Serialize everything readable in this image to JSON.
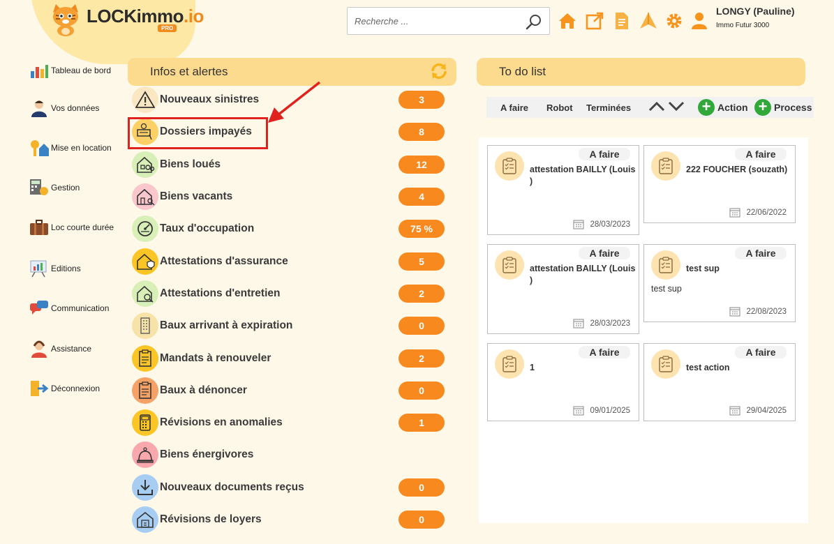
{
  "header": {
    "logo_main": "LOCKimmo",
    "logo_suffix": ".io",
    "logo_badge": "PRO",
    "search_placeholder": "Recherche ...",
    "user_name": "LONGY (Pauline)",
    "user_company": "Immo Futur 3000"
  },
  "icons": {
    "accent": "#f08a1c",
    "badge_color": "#f7891f",
    "panel_color": "#fddb8e",
    "highlight_color": "#e0221f"
  },
  "sidebar": {
    "items": [
      {
        "label": "Tableau de bord",
        "icon": "dashboard-icon"
      },
      {
        "label": "Vos données",
        "icon": "person-icon"
      },
      {
        "label": "Mise en location",
        "icon": "key-house-icon"
      },
      {
        "label": "Gestion",
        "icon": "calculator-icon"
      },
      {
        "label": "Loc courte durée",
        "icon": "suitcase-icon"
      },
      {
        "label": "Editions",
        "icon": "report-icon"
      },
      {
        "label": "Communication",
        "icon": "chat-icon"
      },
      {
        "label": "Assistance",
        "icon": "support-icon"
      },
      {
        "label": "Déconnexion",
        "icon": "logout-icon"
      }
    ]
  },
  "alerts": {
    "title": "Infos et alertes",
    "items": [
      {
        "label": "Nouveaux sinistres",
        "count": "3"
      },
      {
        "label": "Dossiers impayés",
        "count": "8"
      },
      {
        "label": "Biens loués",
        "count": "12"
      },
      {
        "label": "Biens vacants",
        "count": "4"
      },
      {
        "label": "Taux d'occupation",
        "count": "75 %"
      },
      {
        "label": "Attestations d'assurance",
        "count": "5"
      },
      {
        "label": "Attestations d'entretien",
        "count": "2"
      },
      {
        "label": "Baux arrivant à expiration",
        "count": "0"
      },
      {
        "label": "Mandats à renouveler",
        "count": "2"
      },
      {
        "label": "Baux à dénoncer",
        "count": "0"
      },
      {
        "label": "Révisions en anomalies",
        "count": "1"
      },
      {
        "label": "Biens énergivores",
        "count": ""
      },
      {
        "label": "Nouveaux documents reçus",
        "count": "0"
      },
      {
        "label": "Révisions de loyers",
        "count": "0"
      }
    ]
  },
  "todo": {
    "title": "To do list",
    "tabs": [
      "A faire",
      "Robot",
      "Terminées"
    ],
    "action_label": "Action",
    "process_label": "Process",
    "cards": [
      {
        "status": "A faire",
        "title": "attestation BAILLY (Louis )",
        "desc": "",
        "date": "28/03/2023"
      },
      {
        "status": "A faire",
        "title": "222 FOUCHER (souzath)",
        "desc": "",
        "date": "22/06/2022"
      },
      {
        "status": "A faire",
        "title": "attestation BAILLY (Louis )",
        "desc": "",
        "date": "28/03/2023"
      },
      {
        "status": "A faire",
        "title": "test sup",
        "desc": "test sup",
        "date": "22/08/2023"
      },
      {
        "status": "A faire",
        "title": "1",
        "desc": "",
        "date": "09/01/2025"
      },
      {
        "status": "A faire",
        "title": "test action",
        "desc": "",
        "date": "29/04/2025"
      }
    ]
  }
}
